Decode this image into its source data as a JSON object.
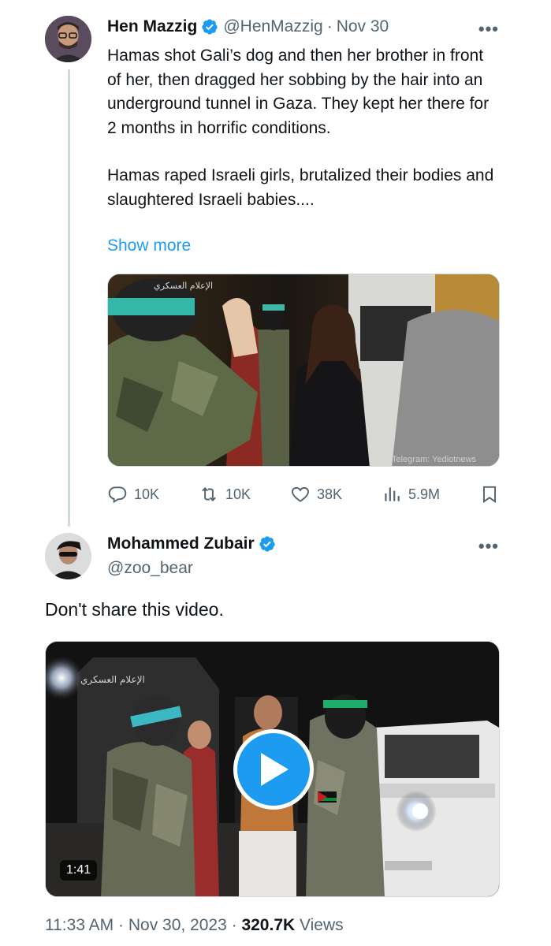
{
  "quoted_tweet": {
    "name": "Hen Mazzig",
    "handle": "@HenMazzig",
    "separator": "·",
    "date": "Nov 30",
    "more": "•••",
    "paragraph1": "Hamas shot Gali’s dog and then her brother in front of her, then dragged her sobbing by the hair into an underground tunnel in Gaza. They kept her there for 2 months in horrific conditions.",
    "paragraph2": "Hamas raped Israeli girls, brutalized their bodies and slaughtered Israeli babies....",
    "show_more": "Show more",
    "media_watermark": "Telegram: Yediotnews",
    "media_logo": "الإعلام العسكري",
    "stats": {
      "replies": "10K",
      "reposts": "10K",
      "likes": "38K",
      "views": "5.9M"
    }
  },
  "main_tweet": {
    "name": "Mohammed Zubair",
    "handle": "@zoo_bear",
    "more": "•••",
    "text": "Don't share this video.",
    "media_logo": "الإعلام العسكري",
    "video_duration": "1:41",
    "footer": {
      "time": "11:33 AM",
      "sep1": " · ",
      "date": "Nov 30, 2023",
      "sep2": " · ",
      "views_count": "320.7K",
      "views_label": " Views"
    }
  },
  "colors": {
    "accent": "#1d9bf0",
    "text": "#0f1419",
    "secondary": "#536471"
  }
}
